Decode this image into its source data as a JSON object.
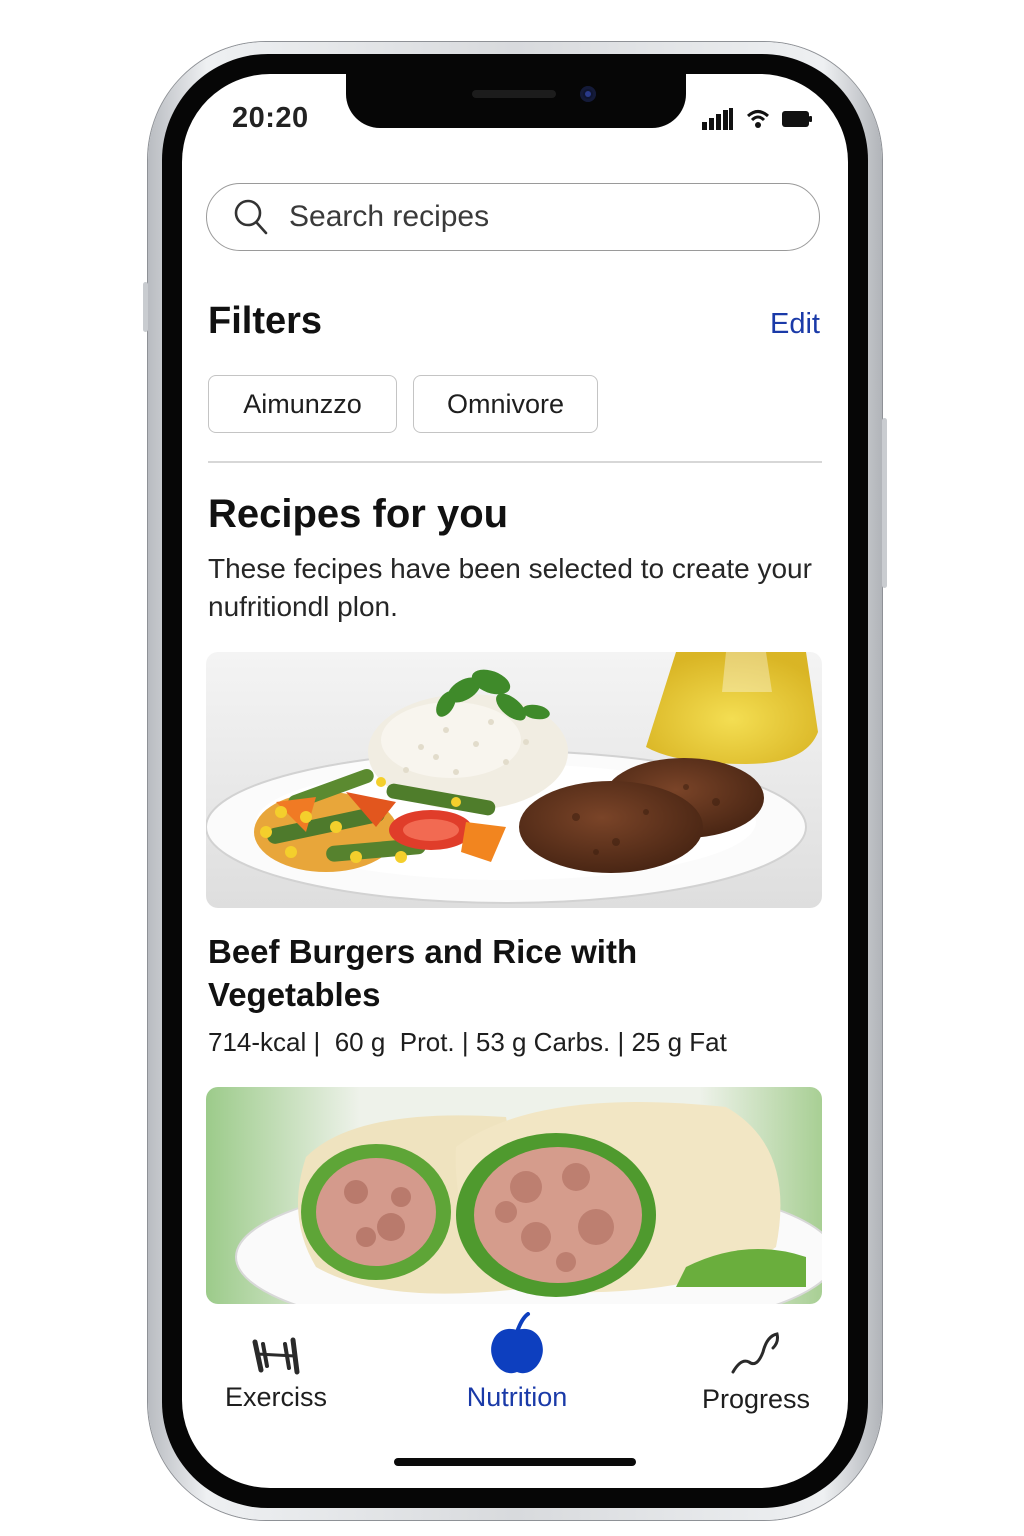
{
  "status_bar": {
    "time": "20:20",
    "icons": [
      "signal-bars-icon",
      "wifi-icon",
      "battery-icon"
    ]
  },
  "search": {
    "placeholder": "Search recipes"
  },
  "filters": {
    "title": "Filters",
    "edit_label": "Edit",
    "chips": [
      {
        "label": "Aimunzzo"
      },
      {
        "label": "Omnivore"
      }
    ]
  },
  "recipes_section": {
    "title": "Recipes for you",
    "subtitle": "These fecipes have been selected to create your nufritiondl plon."
  },
  "recipes": [
    {
      "title": "Beef Burgers and Rice with Vegetables",
      "macros": "714-kcal |  60 g  Prot. | 53 g Carbs. | 25 g Fat",
      "image": "beef-burgers-rice-vegetables-photo"
    },
    {
      "image": "tuna-wrap-photo"
    }
  ],
  "tab_bar": {
    "tabs": [
      {
        "label": "Exerciss",
        "icon": "dumbbell-icon",
        "active": false
      },
      {
        "label": "Nutrition",
        "icon": "apple-icon",
        "active": true
      },
      {
        "label": "Progress",
        "icon": "trend-line-icon",
        "active": false
      }
    ]
  },
  "colors": {
    "accent": "#1a3aa8",
    "nutrition_icon": "#0d3fbf",
    "text": "#111111",
    "frame": "#d8dadd"
  }
}
